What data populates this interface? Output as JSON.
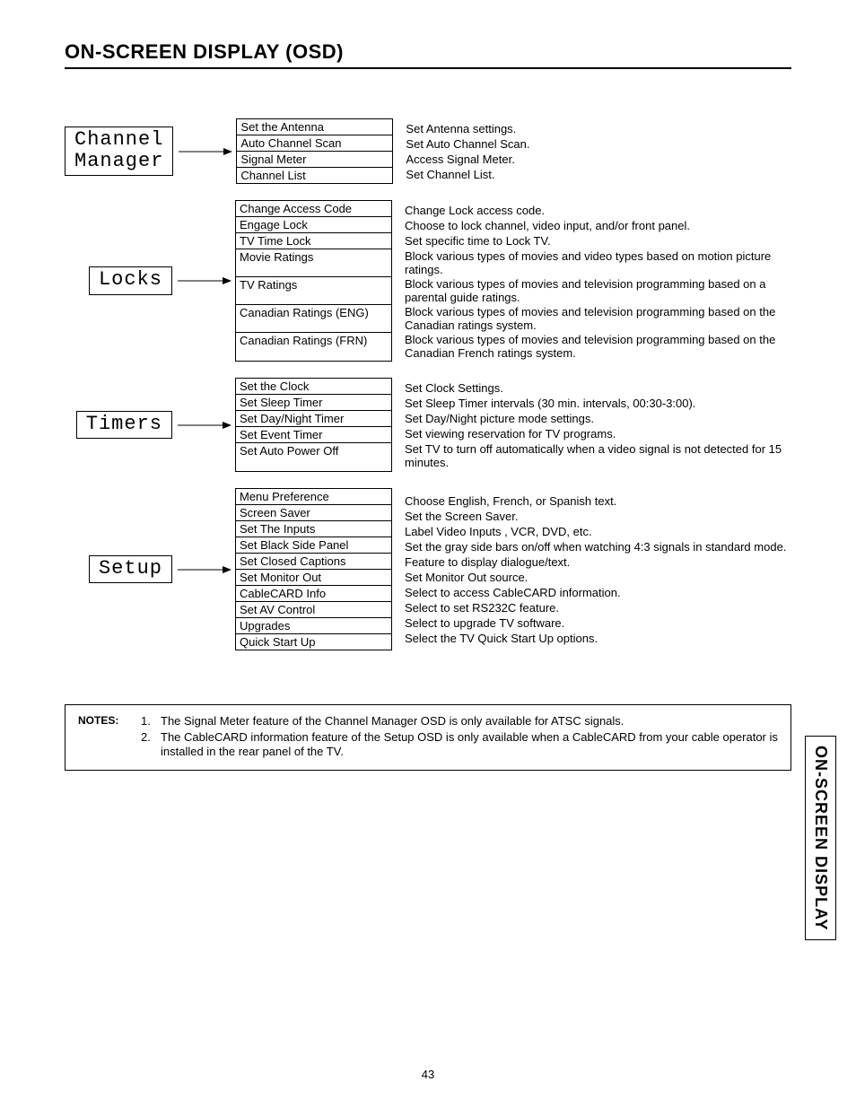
{
  "title": "ON-SCREEN DISPLAY (OSD)",
  "sidetab": "ON-SCREEN DISPLAY",
  "pagenum": "43",
  "sections": [
    {
      "category": "Channel\nManager",
      "rows": [
        {
          "item": "Set the Antenna",
          "desc": "Set Antenna settings."
        },
        {
          "item": "Auto Channel Scan",
          "desc": "Set Auto Channel Scan."
        },
        {
          "item": "Signal Meter",
          "desc": "Access Signal Meter."
        },
        {
          "item": "Channel List",
          "desc": "Set Channel List."
        }
      ]
    },
    {
      "category": "Locks",
      "rows": [
        {
          "item": "Change Access Code",
          "desc": "Change Lock access code."
        },
        {
          "item": "Engage Lock",
          "desc": "Choose to lock channel, video input, and/or front panel."
        },
        {
          "item": "TV Time Lock",
          "desc": "Set specific time to Lock TV."
        },
        {
          "item": "Movie Ratings",
          "desc": "Block various types of movies and video types based on motion picture ratings.",
          "tall": true
        },
        {
          "item": "TV Ratings",
          "desc": "Block various types of movies and television programming based on a parental guide ratings.",
          "tall": true
        },
        {
          "item": "Canadian Ratings (ENG)",
          "desc": "Block various types of movies and television programming based on the Canadian ratings system.",
          "tall": true
        },
        {
          "item": "Canadian Ratings (FRN)",
          "desc": "Block various types of movies and television programming based on the Canadian French ratings system.",
          "tall": true
        }
      ]
    },
    {
      "category": "Timers",
      "rows": [
        {
          "item": "Set the Clock",
          "desc": "Set Clock Settings."
        },
        {
          "item": "Set Sleep Timer",
          "desc": "Set Sleep Timer intervals (30 min. intervals, 00:30-3:00)."
        },
        {
          "item": "Set Day/Night Timer",
          "desc": "Set Day/Night picture mode settings."
        },
        {
          "item": "Set Event Timer",
          "desc": "Set viewing reservation for TV programs."
        },
        {
          "item": "Set Auto Power Off",
          "desc": "Set TV to turn off automatically when a video signal is not detected for 15 minutes.",
          "tall": true
        }
      ]
    },
    {
      "category": "Setup",
      "rows": [
        {
          "item": "Menu Preference",
          "desc": "Choose English, French, or Spanish text."
        },
        {
          "item": "Screen Saver",
          "desc": "Set the Screen Saver."
        },
        {
          "item": "Set The Inputs",
          "desc": "Label Video Inputs , VCR, DVD, etc."
        },
        {
          "item": "Set Black Side Panel",
          "desc": "Set the gray side bars on/off when watching 4:3 signals in standard mode."
        },
        {
          "item": "Set Closed Captions",
          "desc": "Feature to display dialogue/text."
        },
        {
          "item": "Set Monitor Out",
          "desc": "Set Monitor Out source."
        },
        {
          "item": "CableCARD Info",
          "desc": "Select to access CableCARD information."
        },
        {
          "item": "Set AV Control",
          "desc": "Select to set RS232C feature."
        },
        {
          "item": "Upgrades",
          "desc": "Select to upgrade TV software."
        },
        {
          "item": "Quick Start Up",
          "desc": "Select the TV Quick Start Up options."
        }
      ]
    }
  ],
  "notes": {
    "label": "NOTES:",
    "items": [
      {
        "num": "1.",
        "text": "The Signal Meter feature of the Channel Manager OSD is only available for ATSC signals."
      },
      {
        "num": "2.",
        "text": "The CableCARD information feature of the Setup OSD is only available when a CableCARD from your cable operator is installed in the rear panel of the TV."
      }
    ]
  }
}
